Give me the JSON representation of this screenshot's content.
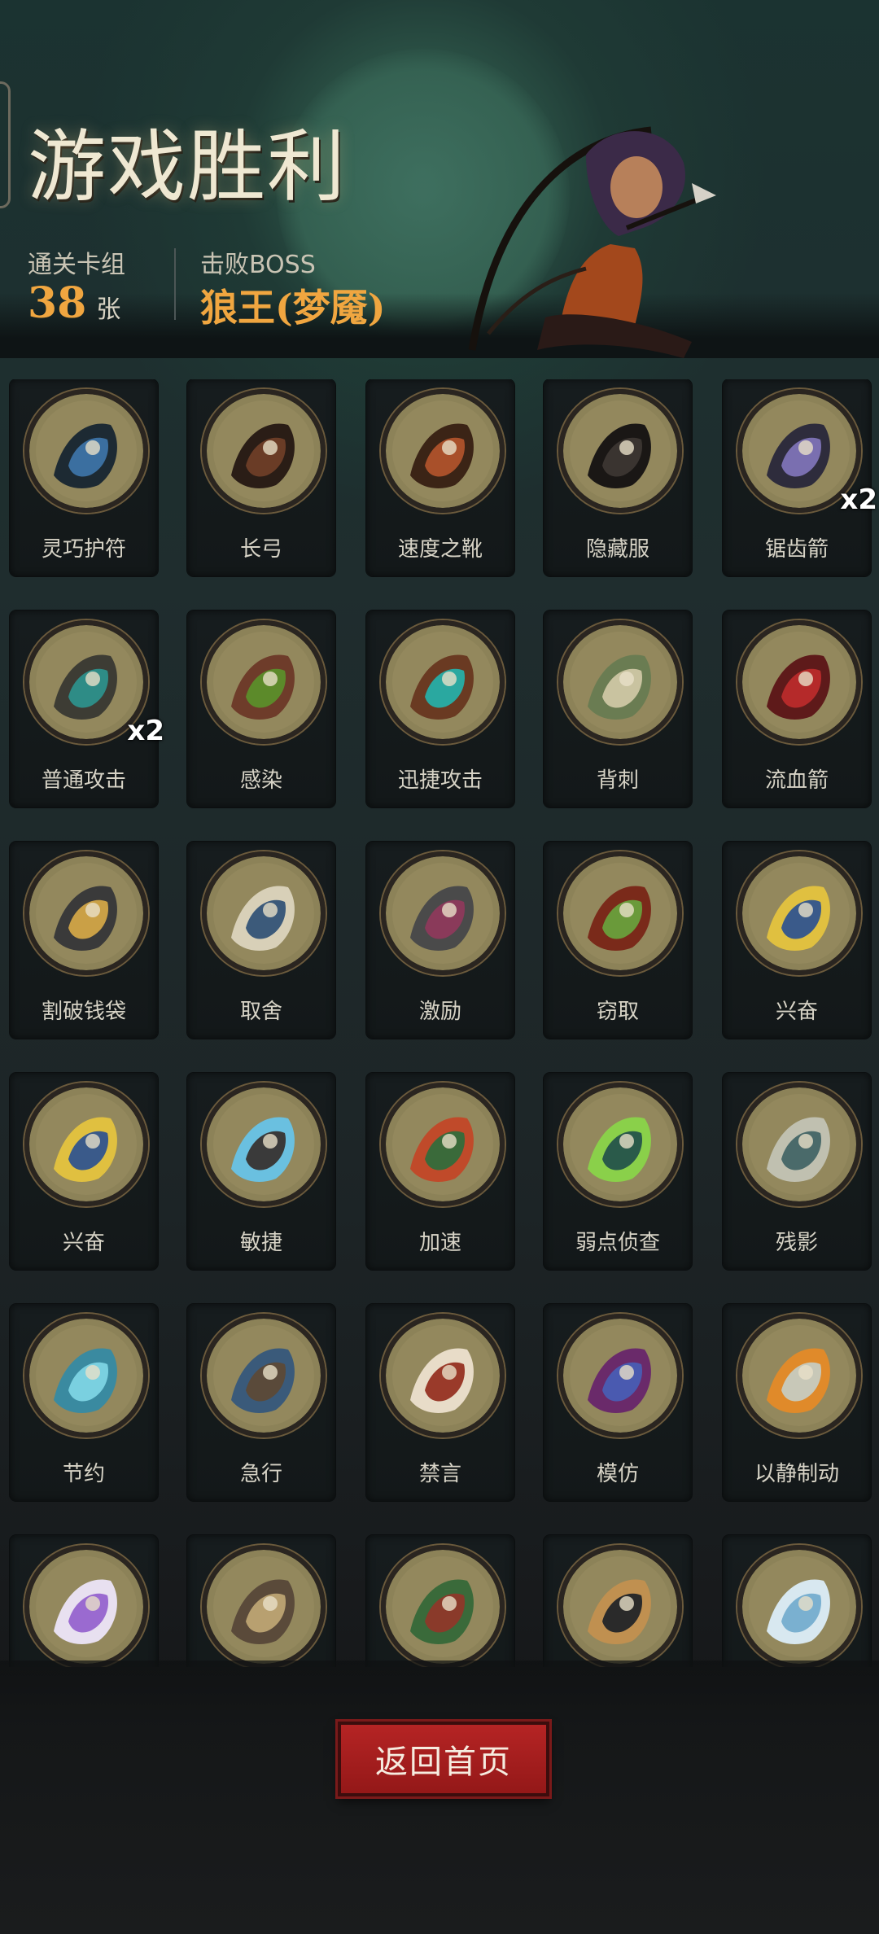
{
  "header": {
    "title": "游戏胜利",
    "deck_label": "通关卡组",
    "deck_count": "38",
    "deck_unit": "张",
    "boss_label": "击败BOSS",
    "boss_name": "狼王(梦魇)"
  },
  "cards": [
    {
      "label": "灵巧护符",
      "multiplier": "",
      "icon": "amulet-icon"
    },
    {
      "label": "长弓",
      "multiplier": "",
      "icon": "longbow-icon"
    },
    {
      "label": "速度之靴",
      "multiplier": "",
      "icon": "boot-icon"
    },
    {
      "label": "隐藏服",
      "multiplier": "",
      "icon": "hooded-cloak-icon"
    },
    {
      "label": "锯齿箭",
      "multiplier": "x2",
      "icon": "serrated-arrow-icon"
    },
    {
      "label": "普通攻击",
      "multiplier": "x2",
      "icon": "arrows-volley-icon"
    },
    {
      "label": "感染",
      "multiplier": "",
      "icon": "infected-toad-icon"
    },
    {
      "label": "迅捷攻击",
      "multiplier": "",
      "icon": "swift-strike-icon"
    },
    {
      "label": "背刺",
      "multiplier": "",
      "icon": "backstab-icon"
    },
    {
      "label": "流血箭",
      "multiplier": "",
      "icon": "bleeding-arrow-icon"
    },
    {
      "label": "割破钱袋",
      "multiplier": "",
      "icon": "cut-purse-icon"
    },
    {
      "label": "取舍",
      "multiplier": "",
      "icon": "wise-elder-icon"
    },
    {
      "label": "激励",
      "multiplier": "",
      "icon": "hammer-warrior-icon"
    },
    {
      "label": "窃取",
      "multiplier": "",
      "icon": "goblin-chest-icon"
    },
    {
      "label": "兴奋",
      "multiplier": "",
      "icon": "excited-dwarf-icon"
    },
    {
      "label": "兴奋",
      "multiplier": "",
      "icon": "excited-dwarf-icon"
    },
    {
      "label": "敏捷",
      "multiplier": "",
      "icon": "lightning-panther-icon"
    },
    {
      "label": "加速",
      "multiplier": "",
      "icon": "witch-icon"
    },
    {
      "label": "弱点侦查",
      "multiplier": "",
      "icon": "wolf-eye-icon"
    },
    {
      "label": "残影",
      "multiplier": "",
      "icon": "afterimage-icon"
    },
    {
      "label": "节约",
      "multiplier": "",
      "icon": "water-drop-icon"
    },
    {
      "label": "急行",
      "multiplier": "",
      "icon": "running-dwarf-icon"
    },
    {
      "label": "禁言",
      "multiplier": "",
      "icon": "silence-girl-icon"
    },
    {
      "label": "模仿",
      "multiplier": "",
      "icon": "troll-face-icon"
    },
    {
      "label": "以静制动",
      "multiplier": "",
      "icon": "skull-flame-icon"
    },
    {
      "label": "",
      "multiplier": "",
      "icon": "potion-icon"
    },
    {
      "label": "",
      "multiplier": "",
      "icon": "treasure-map-icon"
    },
    {
      "label": "",
      "multiplier": "",
      "icon": "battle-scene-icon"
    },
    {
      "label": "",
      "multiplier": "",
      "icon": "rogue-icon"
    },
    {
      "label": "",
      "multiplier": "",
      "icon": "crystal-orb-icon"
    }
  ],
  "footer": {
    "back_button": "返回首页"
  },
  "colors": {
    "accent": "#f0a640",
    "button": "#a41e1e",
    "disc": "#8c8258"
  }
}
